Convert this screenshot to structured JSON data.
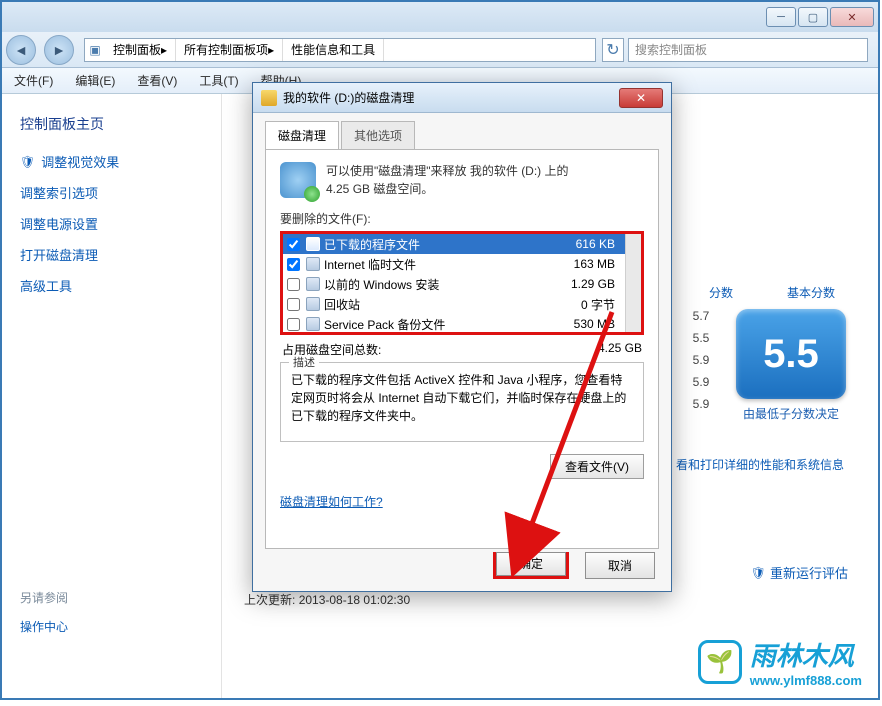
{
  "window": {
    "breadcrumb": [
      "控制面板",
      "所有控制面板项",
      "性能信息和工具"
    ],
    "search_placeholder": "搜索控制面板"
  },
  "menu": {
    "file": "文件(F)",
    "edit": "编辑(E)",
    "view": "查看(V)",
    "tools": "工具(T)",
    "help": "帮助(H)"
  },
  "sidebar": {
    "heading": "控制面板主页",
    "links": [
      {
        "label": "调整视觉效果",
        "shield": true
      },
      {
        "label": "调整索引选项",
        "shield": false
      },
      {
        "label": "调整电源设置",
        "shield": false
      },
      {
        "label": "打开磁盘清理",
        "shield": false
      },
      {
        "label": "高级工具",
        "shield": false
      }
    ],
    "see_also": "另请参阅",
    "action_center": "操作中心"
  },
  "main": {
    "score_headers": {
      "sub": "分数",
      "base": "基本分数"
    },
    "sub_scores": [
      "5.7",
      "5.5",
      "5.9",
      "5.9",
      "5.9"
    ],
    "big_score": "5.5",
    "big_caption": "由最低子分数决定",
    "detail_link": "看和打印详细的性能和系统信息",
    "rerun_link": "重新运行评估",
    "last_update_label": "上次更新:",
    "last_update_value": "2013-08-18 01:02:30"
  },
  "dialog": {
    "title": "我的软件 (D:)的磁盘清理",
    "tabs": {
      "cleanup": "磁盘清理",
      "other": "其他选项"
    },
    "info_text_1": "可以使用\"磁盘清理\"来释放 我的软件 (D:) 上的",
    "info_text_2": "4.25 GB 磁盘空间。",
    "files_to_delete_label": "要删除的文件(F):",
    "files": [
      {
        "name": "已下载的程序文件",
        "size": "616 KB",
        "checked": true,
        "selected": true
      },
      {
        "name": "Internet 临时文件",
        "size": "163 MB",
        "checked": true,
        "selected": false
      },
      {
        "name": "以前的 Windows 安装",
        "size": "1.29 GB",
        "checked": false,
        "selected": false
      },
      {
        "name": "回收站",
        "size": "0 字节",
        "checked": false,
        "selected": false
      },
      {
        "name": "Service Pack 备份文件",
        "size": "530 MB",
        "checked": false,
        "selected": false
      }
    ],
    "total_label": "占用磁盘空间总数:",
    "total_value": "4.25 GB",
    "desc_label": "描述",
    "desc_text": "已下载的程序文件包括 ActiveX 控件和 Java 小程序，您查看特定网页时将会从 Internet 自动下载它们，并临时保存在硬盘上的已下载的程序文件夹中。",
    "view_files_btn": "查看文件(V)",
    "help_link": "磁盘清理如何工作?",
    "ok_btn": "确定",
    "cancel_btn": "取消"
  },
  "watermark": {
    "brand": "雨林木风",
    "url": "www.ylmf888.com"
  }
}
